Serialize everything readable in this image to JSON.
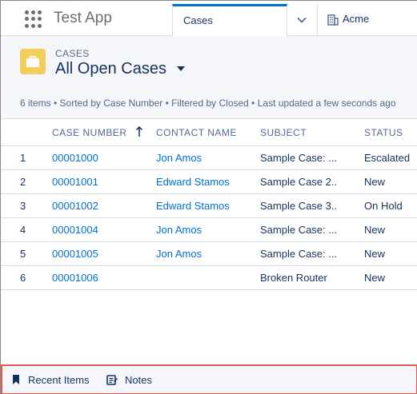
{
  "app": {
    "name": "Test App"
  },
  "tabs": [
    {
      "label": "Cases",
      "active": true
    },
    {
      "label": "Acme",
      "icon": "building-icon"
    }
  ],
  "list_view": {
    "object_label": "CASES",
    "title": "All Open Cases",
    "meta": "6 items • Sorted by Case Number • Filtered by Closed • Last updated a few seconds ago",
    "columns": [
      "CASE NUMBER",
      "CONTACT NAME",
      "SUBJECT",
      "STATUS"
    ],
    "sort": {
      "column": "CASE NUMBER",
      "direction": "ascending"
    },
    "rows": [
      {
        "num": "1",
        "case_number": "00001000",
        "contact": "Jon Amos",
        "subject": "Sample Case: ...",
        "status": "Escalated"
      },
      {
        "num": "2",
        "case_number": "00001001",
        "contact": "Edward Stamos",
        "subject": "Sample Case 2...",
        "status": "New"
      },
      {
        "num": "3",
        "case_number": "00001002",
        "contact": "Edward Stamos",
        "subject": "Sample Case 3...",
        "status": "On Hold"
      },
      {
        "num": "4",
        "case_number": "00001004",
        "contact": "Jon Amos",
        "subject": "Sample Case: ...",
        "status": "New"
      },
      {
        "num": "5",
        "case_number": "00001005",
        "contact": "Jon Amos",
        "subject": "Sample Case: ...",
        "status": "New"
      },
      {
        "num": "6",
        "case_number": "00001006",
        "contact": "",
        "subject": "Broken Router",
        "status": "New"
      }
    ]
  },
  "utility_bar": {
    "items": [
      {
        "label": "Recent Items",
        "icon": "bookmark-icon"
      },
      {
        "label": "Notes",
        "icon": "note-icon"
      }
    ]
  },
  "colors": {
    "link": "#0070d2",
    "text": "#16325c",
    "muted": "#54698d",
    "header_bg": "#f4f6f9",
    "case_icon_bg": "#f2cf5b",
    "highlight_border": "#e05a52",
    "active_tab": "#0070d2"
  }
}
